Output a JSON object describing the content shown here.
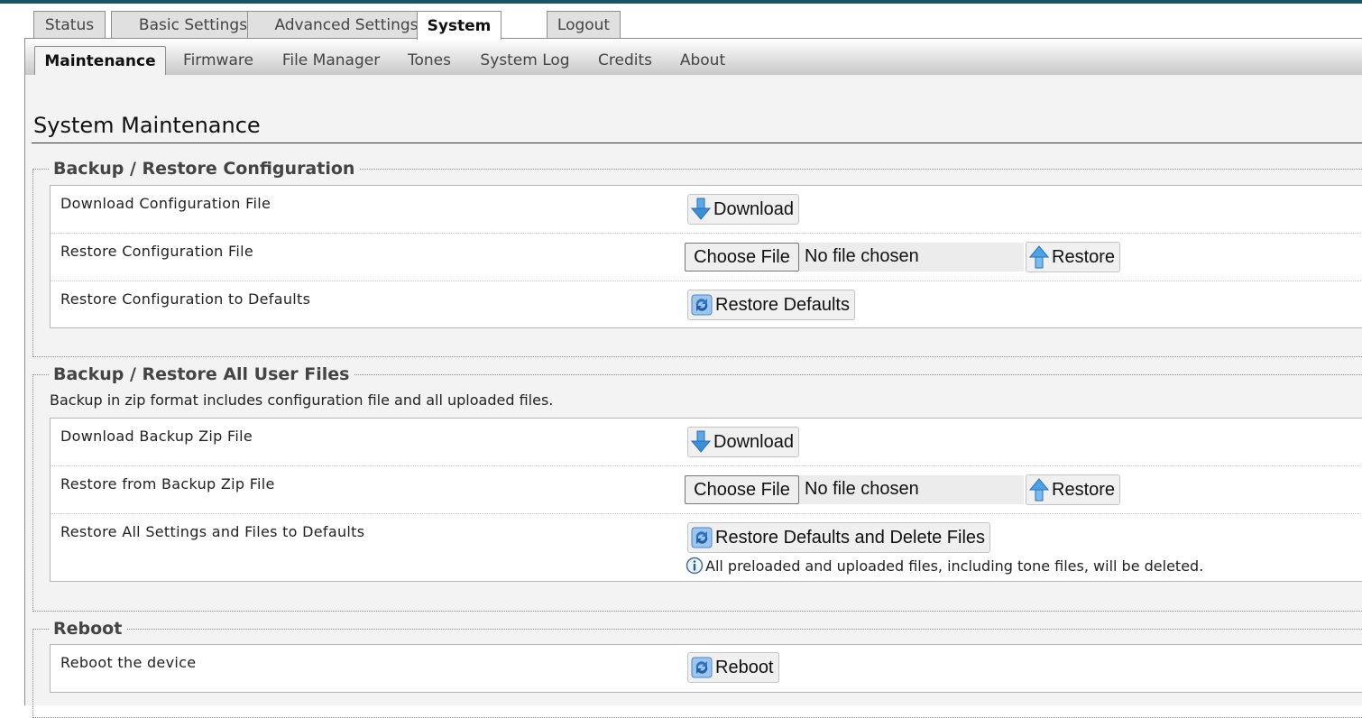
{
  "main_tabs": [
    {
      "label": "Status"
    },
    {
      "label": "Basic Settings"
    },
    {
      "label": "Advanced Settings"
    },
    {
      "label": "System"
    },
    {
      "label": "Logout"
    }
  ],
  "active_main_tab": "System",
  "sub_tabs": [
    {
      "label": "Maintenance"
    },
    {
      "label": "Firmware"
    },
    {
      "label": "File Manager"
    },
    {
      "label": "Tones"
    },
    {
      "label": "System Log"
    },
    {
      "label": "Credits"
    },
    {
      "label": "About"
    }
  ],
  "active_sub_tab": "Maintenance",
  "page_title": "System Maintenance",
  "config_section": {
    "legend": "Backup / Restore Configuration",
    "rows": [
      {
        "label": "Download Configuration File",
        "button": "Download"
      },
      {
        "label": "Restore Configuration File",
        "choose_file": "Choose File",
        "file_status": "No file chosen",
        "button": "Restore"
      },
      {
        "label": "Restore Configuration to Defaults",
        "button": "Restore Defaults"
      }
    ]
  },
  "userfiles_section": {
    "legend": "Backup / Restore All User Files",
    "description": "Backup in zip format includes configuration file and all uploaded files.",
    "rows": [
      {
        "label": "Download Backup Zip File",
        "button": "Download"
      },
      {
        "label": "Restore from Backup Zip File",
        "choose_file": "Choose File",
        "file_status": "No file chosen",
        "button": "Restore"
      },
      {
        "label": "Restore All Settings and Files to Defaults",
        "button": "Restore Defaults and Delete Files",
        "note": "All preloaded and uploaded files, including tone files, will be deleted."
      }
    ]
  },
  "reboot_section": {
    "legend": "Reboot",
    "rows": [
      {
        "label": "Reboot the device",
        "button": "Reboot"
      }
    ]
  },
  "colors": {
    "top_bar": "#1a5566",
    "page_bg": "#f3f3f3",
    "download_icon": "#3a8fd9",
    "restore_icon": "#4aa3e8"
  },
  "icons": {
    "download": "download-arrow-icon",
    "restore": "upload-arrow-icon",
    "refresh": "refresh-icon",
    "info": "info-icon"
  }
}
